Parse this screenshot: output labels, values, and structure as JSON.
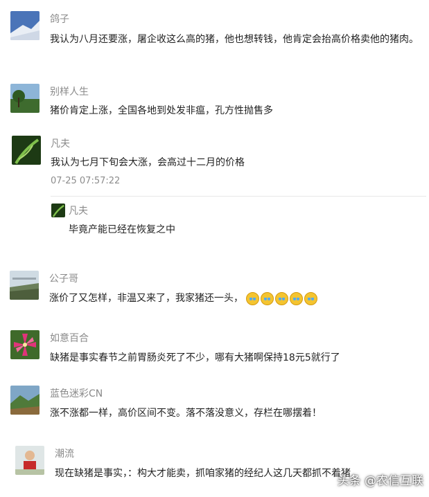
{
  "comments": [
    {
      "username": "鸽子",
      "text": "我认为八月还要涨，屠企收这么高的猪，他也想转钱，他肯定会抬高价格卖他的猪肉。"
    },
    {
      "username": "别样人生",
      "text": "猪价肯定上涨，全国各地到处发非瘟，孔方性抛售多"
    },
    {
      "username": "凡夫",
      "text": "我认为七月下旬会大涨，会高过十二月的价格",
      "time": "07-25 07:57:22",
      "reply": {
        "username": "凡夫",
        "text": "毕竟产能已经在恢复之中"
      }
    },
    {
      "username": "公子哥",
      "text": "涨价了又怎样，非温又来了，我家猪还一头，",
      "emoji_count": 5
    },
    {
      "username": "如意百合",
      "text": "缺猪是事实春节之前胃肠炎死了不少，哪有大猪啊保持18元5就行了"
    },
    {
      "username": "蓝色迷彩CN",
      "text": "涨不涨都一样，高价区间不变。落不落没意义，存栏在哪摆着！"
    },
    {
      "username": "潮流",
      "text": "现在缺猪是事实，：构大才能卖，抓咱家猪的经纪人这几天都抓不着猪"
    }
  ],
  "watermark": "头条 @农信互联"
}
